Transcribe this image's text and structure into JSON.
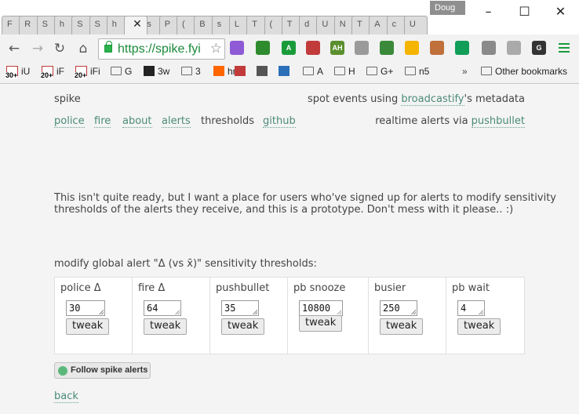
{
  "window": {
    "profile_name": "Doug",
    "tabs": [
      {
        "label": "F"
      },
      {
        "label": "R"
      },
      {
        "label": "S"
      },
      {
        "label": "h"
      },
      {
        "label": "S"
      },
      {
        "label": "S"
      },
      {
        "label": "h"
      },
      {
        "label": "",
        "active": true
      },
      {
        "label": "s"
      },
      {
        "label": "P"
      },
      {
        "label": "("
      },
      {
        "label": "B"
      },
      {
        "label": "s"
      },
      {
        "label": "L"
      },
      {
        "label": "T"
      },
      {
        "label": "("
      },
      {
        "label": "T"
      },
      {
        "label": "d"
      },
      {
        "label": "U"
      },
      {
        "label": "N"
      },
      {
        "label": "T"
      },
      {
        "label": "A"
      },
      {
        "label": "c"
      },
      {
        "label": "U"
      }
    ],
    "minimize": "–",
    "maximize": "☐",
    "close": "✕"
  },
  "toolbar": {
    "url": "https://spike.fyi",
    "back_icon": "←",
    "forward_icon": "→",
    "reload_icon": "↻",
    "home_icon": "⌂",
    "star_icon": "☆",
    "extensions": [
      {
        "name": "color-ext",
        "color": "#8e5ad6"
      },
      {
        "name": "refresh-ext",
        "color": "#2e8b2e"
      },
      {
        "name": "a-ext",
        "color": "#1a9b3a",
        "label": "A"
      },
      {
        "name": "flag-ext",
        "color": "#c23b3b"
      },
      {
        "name": "ah-ext",
        "color": "#5b8f2e",
        "label": "AH"
      },
      {
        "name": "rss-ext",
        "color": "#9a9a9a"
      },
      {
        "name": "evernote-ext",
        "color": "#3b8a3b"
      },
      {
        "name": "drive-ext",
        "color": "#f4b400"
      },
      {
        "name": "sumo-ext",
        "color": "#c0703a"
      },
      {
        "name": "hangouts-ext",
        "color": "#0f9d58"
      },
      {
        "name": "gray-ext",
        "color": "#8a8a8a"
      },
      {
        "name": "gray2-ext",
        "color": "#aaaaaa"
      },
      {
        "name": "g-ext",
        "color": "#333333",
        "label": "G"
      },
      {
        "name": "menu-icon",
        "color": "#1a9b3a"
      }
    ]
  },
  "bookmarks": {
    "items": [
      {
        "label": "iU",
        "badge": "30+"
      },
      {
        "label": "iF",
        "badge": "20+"
      },
      {
        "label": "iFi",
        "badge": "20+"
      },
      {
        "label": "G"
      },
      {
        "label": "3w"
      },
      {
        "label": "3"
      },
      {
        "label": "hn"
      },
      {
        "label": ""
      },
      {
        "label": ""
      },
      {
        "label": ""
      },
      {
        "label": "A"
      },
      {
        "label": "H"
      },
      {
        "label": "G+"
      },
      {
        "label": "n5"
      }
    ],
    "overflow": "»",
    "other": "Other bookmarks"
  },
  "page": {
    "site_name": "spike",
    "tagline_pre": "spot events using ",
    "tagline_link": "broadcastify",
    "tagline_post": "'s metadata",
    "nav": {
      "police": "police",
      "fire": "fire",
      "about": "about",
      "alerts": "alerts",
      "thresholds": "thresholds",
      "github": "github"
    },
    "realtime_pre": "realtime alerts via ",
    "realtime_link": "pushbullet",
    "intro_line1": "This isn't quite ready, but I want a place for users who've signed up for alerts to modify sensitivity",
    "intro_line2": "thresholds of the alerts they receive, and this is a prototype. Don't mess with it please.. :)",
    "section_heading": "modify global alert \"Δ (vs x̄)\" sensitivity thresholds:",
    "thresholds": [
      {
        "label": "police Δ",
        "value": "30",
        "button": "tweak"
      },
      {
        "label": "fire Δ",
        "value": "64",
        "button": "tweak"
      },
      {
        "label": "pushbullet",
        "value": "35",
        "button": "tweak"
      },
      {
        "label": "pb snooze",
        "value": "10800",
        "button": "tweak"
      },
      {
        "label": "busier",
        "value": "250",
        "button": "tweak"
      },
      {
        "label": "pb wait",
        "value": "4",
        "button": "tweak"
      }
    ],
    "follow_button": "Follow spike alerts",
    "back_link": "back"
  }
}
